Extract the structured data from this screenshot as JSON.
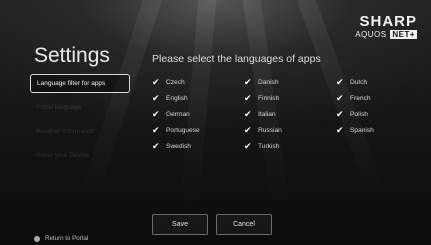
{
  "brand": {
    "name": "SHARP",
    "model": "AQUOS",
    "badge": "NET+"
  },
  "page": {
    "title": "Settings",
    "instruction": "Please select the languages of apps"
  },
  "menu": {
    "items": [
      {
        "label": "Language filter for apps",
        "active": true
      },
      {
        "label": "Portal language",
        "active": false
      },
      {
        "label": "Weather information",
        "active": false
      },
      {
        "label": "Reset your Device",
        "active": false
      }
    ]
  },
  "languages": [
    {
      "label": "Czech",
      "checked": true
    },
    {
      "label": "Danish",
      "checked": true
    },
    {
      "label": "Dutch",
      "checked": true
    },
    {
      "label": "English",
      "checked": true
    },
    {
      "label": "Finnish",
      "checked": true
    },
    {
      "label": "French",
      "checked": true
    },
    {
      "label": "German",
      "checked": true
    },
    {
      "label": "Italian",
      "checked": true
    },
    {
      "label": "Polish",
      "checked": true
    },
    {
      "label": "Portuguese",
      "checked": true
    },
    {
      "label": "Russian",
      "checked": true
    },
    {
      "label": "Spanish",
      "checked": true
    },
    {
      "label": "Swedish",
      "checked": true
    },
    {
      "label": "Turkish",
      "checked": true
    }
  ],
  "buttons": {
    "save": "Save",
    "cancel": "Cancel"
  },
  "footer": {
    "return_label": "Return to Portal"
  },
  "icons": {
    "check": "check-icon",
    "return": "dot-icon"
  }
}
